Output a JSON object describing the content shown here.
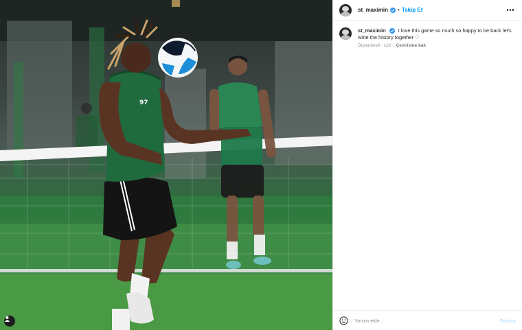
{
  "post": {
    "username": "st_maximin",
    "follow_label": "Takip Et",
    "separator": "•"
  },
  "caption": {
    "username": "st_maximin",
    "text": "I love this game so much so happy to be back let's write the history together ♡",
    "edited": "Düzenlendi · 11d",
    "see_translation": "Çevirisine bak"
  },
  "comment": {
    "placeholder": "Yorum ekle...",
    "share_label": "Paylaş"
  },
  "photo": {
    "jersey_number": "97"
  },
  "colors": {
    "link_blue": "#0095f6",
    "verified_blue": "#3897f0",
    "jersey_green": "#1f6b3e",
    "pitch_green": "#4c9a45"
  }
}
